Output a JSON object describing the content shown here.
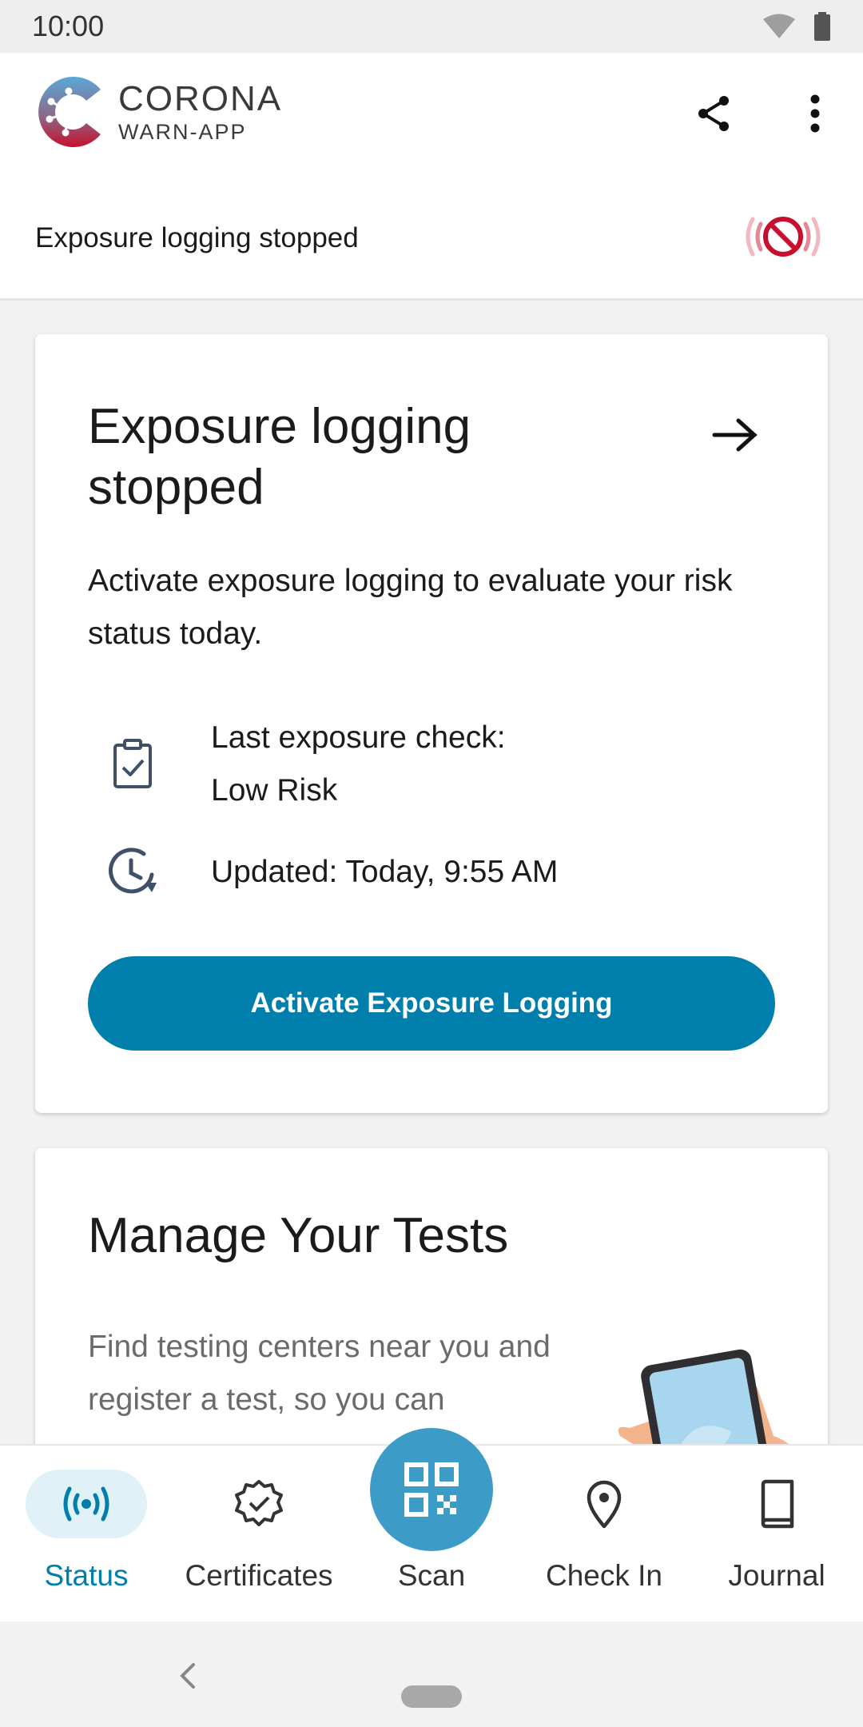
{
  "status_bar": {
    "time": "10:00"
  },
  "header": {
    "logo_title": "CORONA",
    "logo_subtitle": "WARN-APP",
    "logging_status": "Exposure logging stopped"
  },
  "risk_card": {
    "title": "Exposure logging stopped",
    "body": "Activate exposure logging to evaluate your risk status today.",
    "last_check_label": "Last exposure check:",
    "last_check_value": "Low Risk",
    "updated": "Updated: Today, 9:55 AM",
    "button_label": "Activate Exposure Logging"
  },
  "tests_card": {
    "title": "Manage Your Tests",
    "body": "Find testing centers near you and register a test, so you can"
  },
  "bottom_nav": {
    "items": [
      {
        "label": "Status",
        "icon": "broadcast-icon",
        "active": true
      },
      {
        "label": "Certificates",
        "icon": "certificate-badge-icon"
      },
      {
        "label": "Scan",
        "icon": "qr-code-icon"
      },
      {
        "label": "Check In",
        "icon": "location-pin-icon"
      },
      {
        "label": "Journal",
        "icon": "book-icon"
      }
    ]
  },
  "colors": {
    "accent": "#007fad",
    "accent_light": "#e0f1f8",
    "scan_button": "#3d9bc8",
    "alert_red": "#c8102e"
  }
}
